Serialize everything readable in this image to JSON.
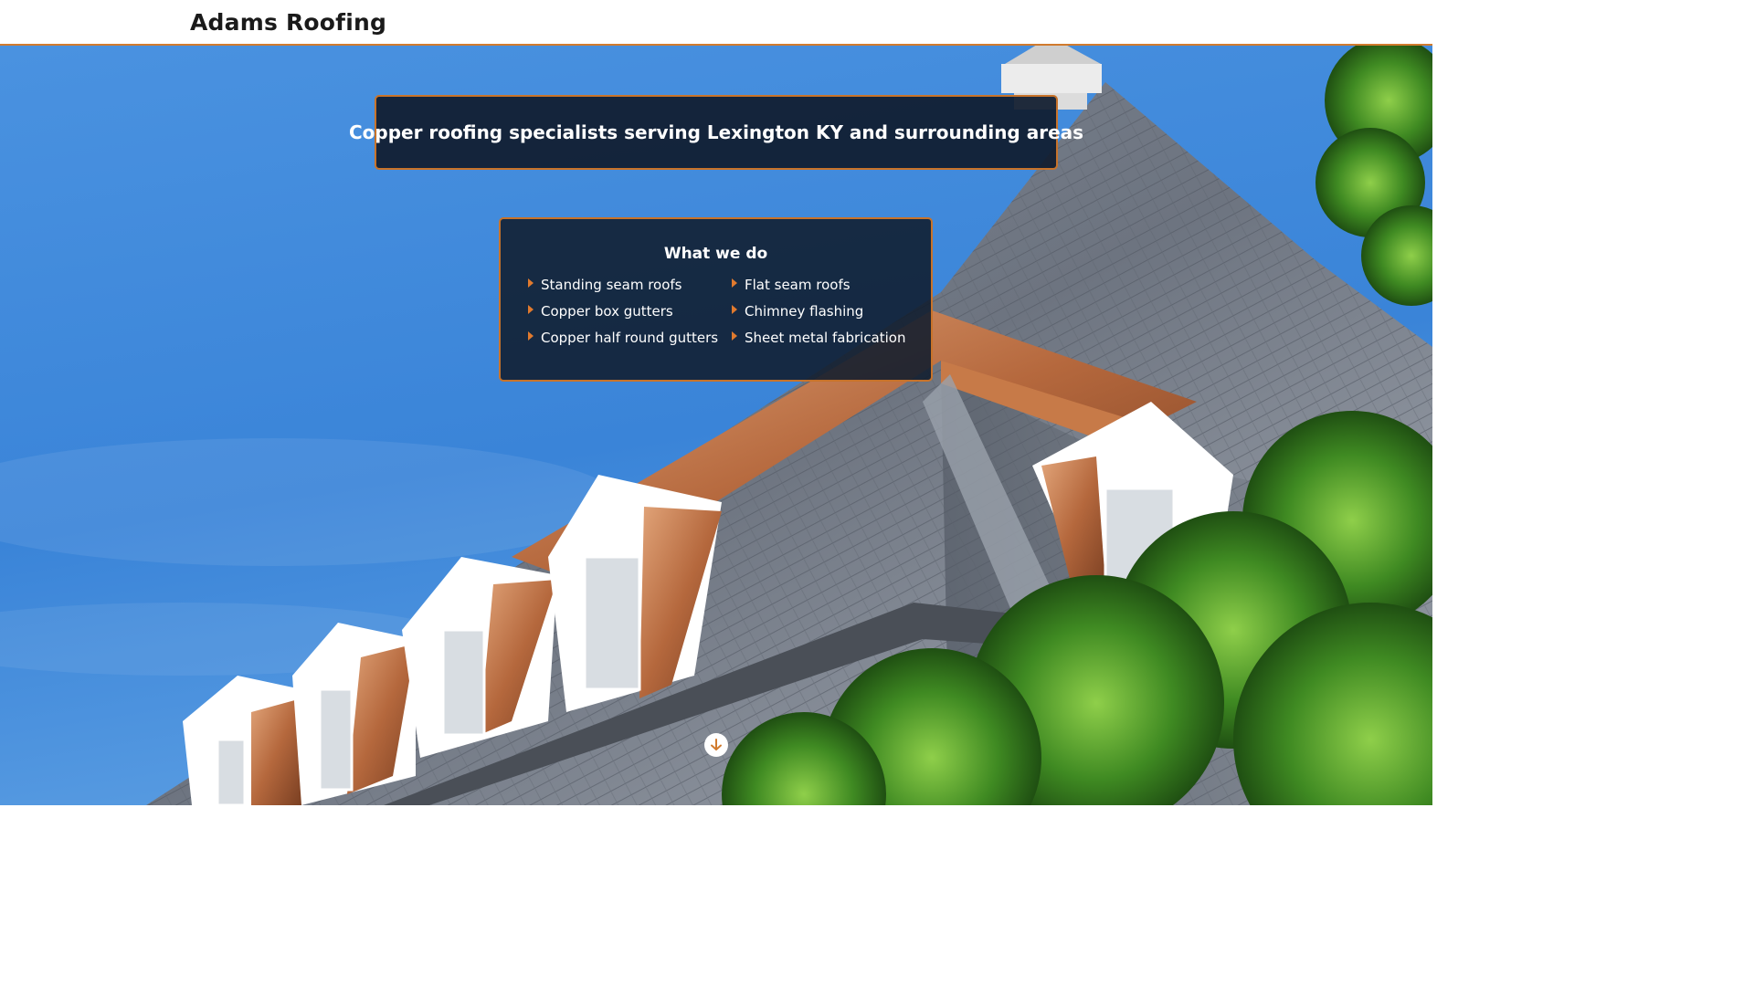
{
  "header": {
    "brand": "Adams Roofing"
  },
  "hero": {
    "tagline": "Copper roofing specialists serving Lexington KY and surrounding areas",
    "scroll_icon": "arrow-down-circle-icon"
  },
  "services": {
    "title": "What we do",
    "items": [
      "Standing seam roofs",
      "Flat seam roofs",
      "Copper box gutters",
      "Chimney flashing",
      "Copper half round gutters",
      "Sheet metal fabrication"
    ],
    "bullet_icon": "caret-right-icon"
  },
  "colors": {
    "accent": "#d17b2e",
    "panel": "#101c2e",
    "sky": "#3c85d6"
  }
}
